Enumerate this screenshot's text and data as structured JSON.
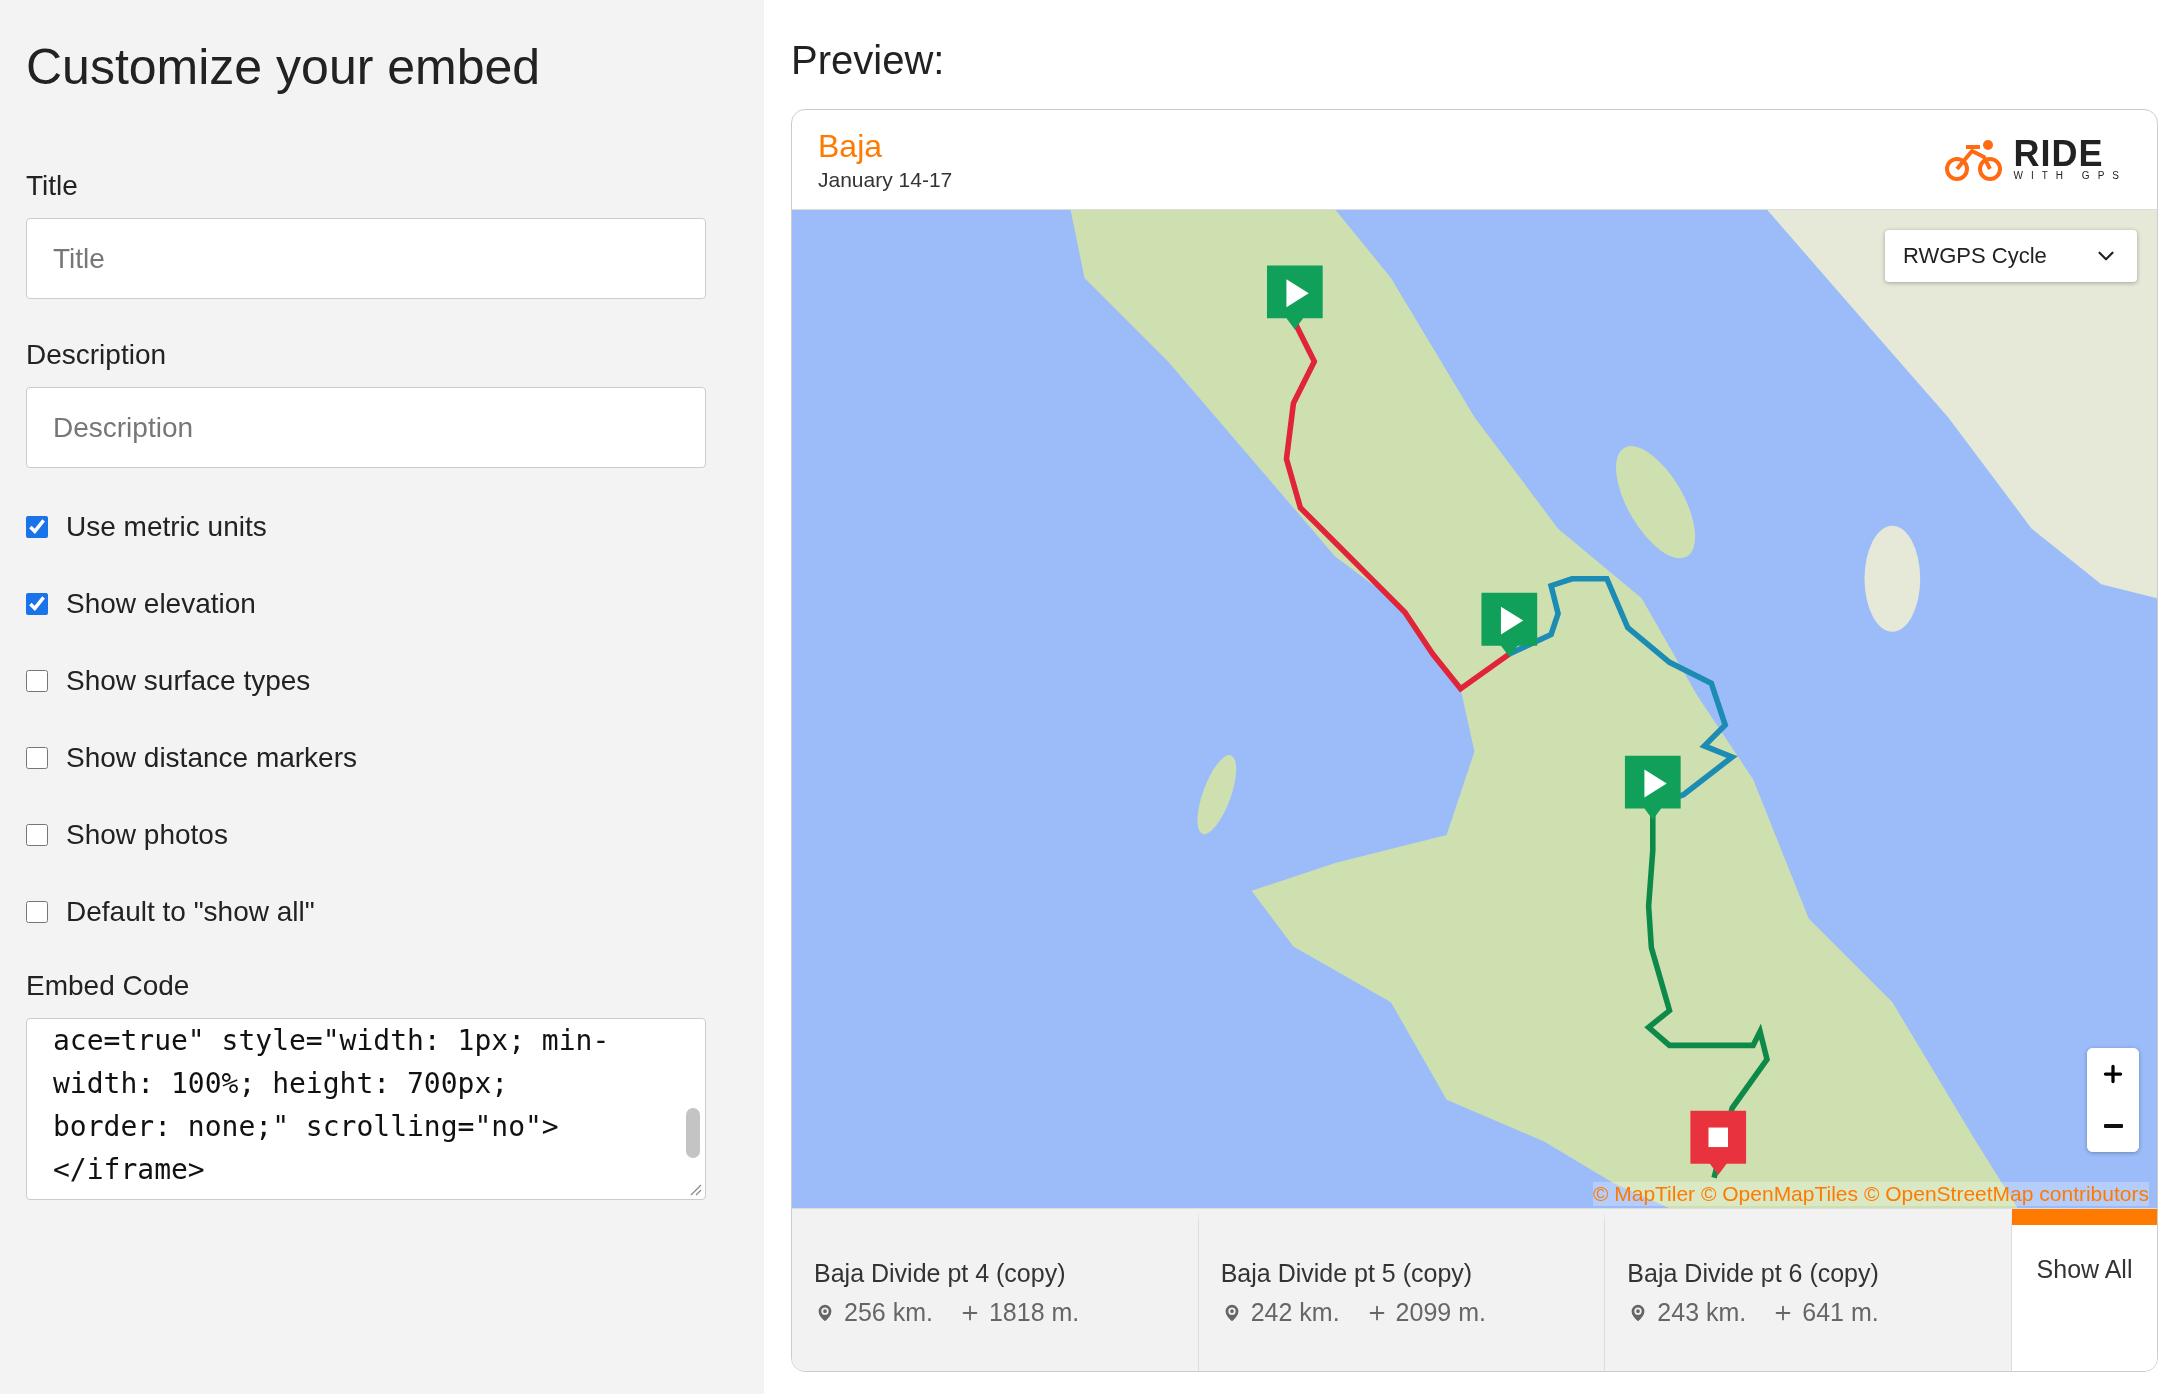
{
  "sidebar": {
    "heading": "Customize your embed",
    "fields": [
      {
        "label": "Title",
        "placeholder": "Title"
      },
      {
        "label": "Description",
        "placeholder": "Description"
      }
    ],
    "options": [
      {
        "label": "Use metric units",
        "checked": true
      },
      {
        "label": "Show elevation",
        "checked": true
      },
      {
        "label": "Show surface types",
        "checked": false
      },
      {
        "label": "Show distance markers",
        "checked": false
      },
      {
        "label": "Show photos",
        "checked": false
      },
      {
        "label": "Default to \"show all\"",
        "checked": false
      }
    ],
    "embed_code": {
      "label": "Embed Code",
      "value": "ace=true\" style=\"width: 1px; min-width: 100%; height: 700px; border: none;\" scrolling=\"no\">\n</iframe>"
    }
  },
  "preview": {
    "heading": "Preview:",
    "title": "Baja",
    "date": "January 14-17",
    "logo": {
      "word": "RIDE",
      "sub": "WITH GPS"
    },
    "map": {
      "layer": "RWGPS Cycle",
      "attribution": "© MapTiler © OpenMapTiles © OpenStreetMap contributors"
    },
    "tabs": [
      {
        "kind": "route",
        "name": "Baja Divide pt 4 (copy)",
        "distance": "256 km.",
        "elevation": "1818 m.",
        "selected": false
      },
      {
        "kind": "route",
        "name": "Baja Divide pt 5 (copy)",
        "distance": "242 km.",
        "elevation": "2099 m.",
        "selected": false
      },
      {
        "kind": "route",
        "name": "Baja Divide pt 6 (copy)",
        "distance": "243 km.",
        "elevation": "641 m.",
        "selected": false
      },
      {
        "kind": "all",
        "name": "Show All",
        "selected": true
      }
    ]
  }
}
